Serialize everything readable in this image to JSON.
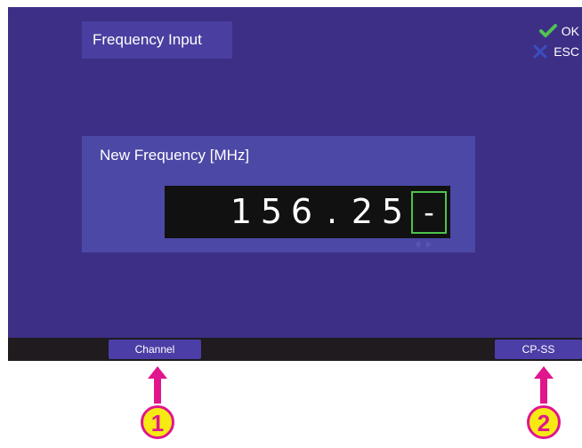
{
  "screen": {
    "title": "Frequency Input",
    "softkeys": {
      "ok_label": "OK",
      "esc_label": "ESC"
    }
  },
  "panel": {
    "label": "New Frequency [MHz]",
    "digits": [
      "1",
      "5",
      "6",
      ".",
      "2",
      "5"
    ],
    "cursor_value": "-"
  },
  "bottom_bar": {
    "left_button": "Channel",
    "right_button": "CP-SS"
  },
  "callouts": {
    "left_number": "1",
    "right_number": "2"
  },
  "colors": {
    "screen_bg": "#3d2f86",
    "panel_bg": "#4c48a6",
    "ok_check": "#4fc24f",
    "esc_x": "#3a4fbf",
    "callout_fill": "#f6ea12",
    "callout_ring": "#e0168d"
  },
  "icons": {
    "ok": "check-icon",
    "esc": "x-icon",
    "hint_left": "triangle-left-icon",
    "hint_right": "triangle-right-icon",
    "callout_arrow": "arrow-up-icon"
  }
}
